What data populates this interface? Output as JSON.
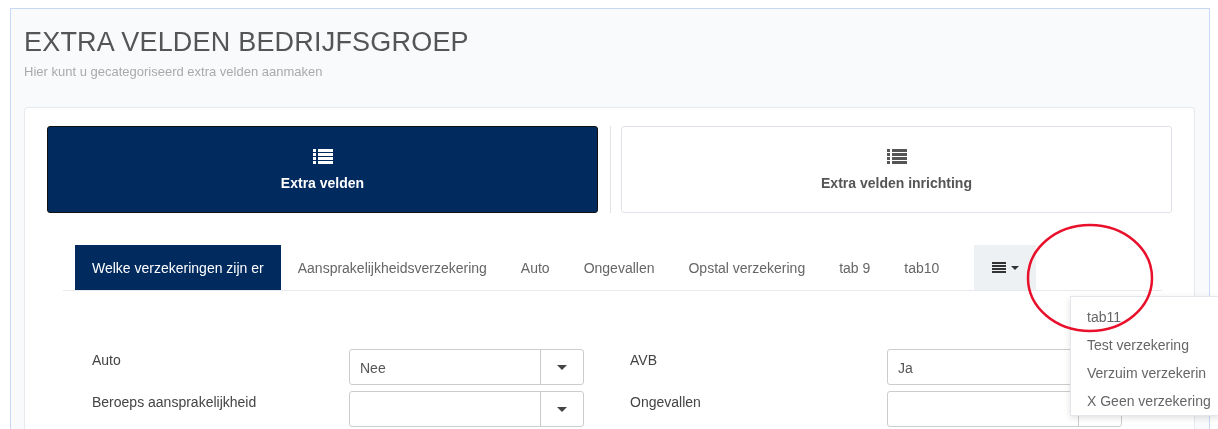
{
  "page": {
    "title": "EXTRA VELDEN BEDRIJFSGROEP",
    "subtitle": "Hier kunt u gecategoriseerd extra velden aanmaken"
  },
  "views": [
    {
      "label": "Extra velden",
      "selected": true
    },
    {
      "label": "Extra velden inrichting",
      "selected": false
    }
  ],
  "tabs": [
    {
      "label": "Welke verzekeringen zijn er",
      "selected": true
    },
    {
      "label": "Aansprakelijkheidsverzekering",
      "selected": false
    },
    {
      "label": "Auto",
      "selected": false
    },
    {
      "label": "Ongevallen",
      "selected": false
    },
    {
      "label": "Opstal verzekering",
      "selected": false
    },
    {
      "label": "tab 9",
      "selected": false
    },
    {
      "label": "tab10",
      "selected": false
    }
  ],
  "overflow_menu": {
    "expanded": true,
    "items": [
      "tab11",
      "Test verzekering",
      "Verzuim verzekerin",
      "X Geen verzekering"
    ]
  },
  "fields": [
    {
      "label": "Auto",
      "value": "Nee"
    },
    {
      "label": "AVB",
      "value": "Ja"
    },
    {
      "label": "Beroeps aansprakelijkheid"
    },
    {
      "label": "Ongevallen"
    }
  ]
}
